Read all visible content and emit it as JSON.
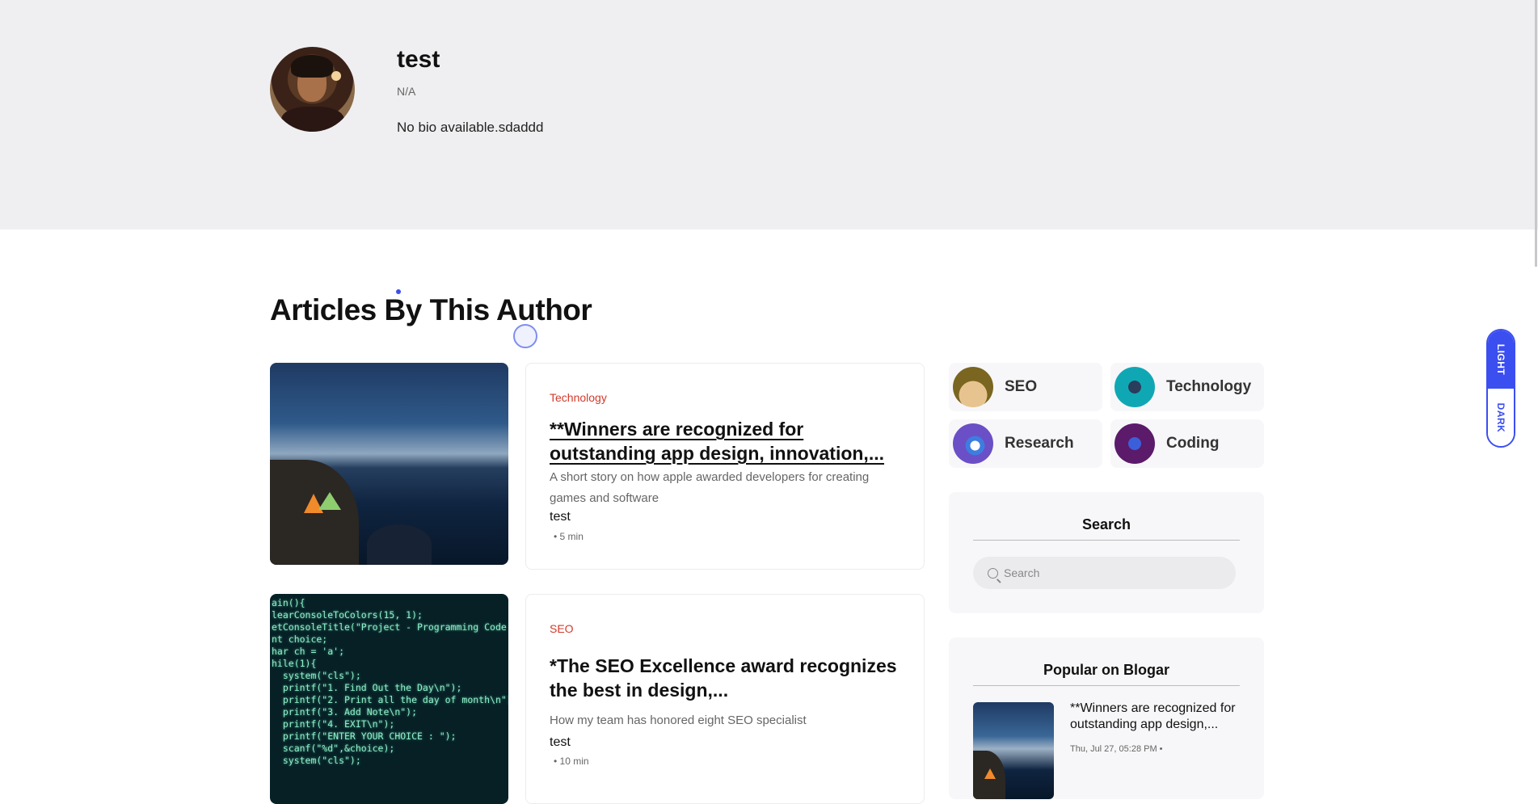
{
  "author": {
    "name": "test",
    "role": "N/A",
    "bio": "No bio available.sdaddd"
  },
  "section": {
    "title": "Articles By This Author"
  },
  "articles": [
    {
      "category": "Technology",
      "title": "**Winners are recognized for outstanding app design, innovation,...",
      "excerpt": "A short story on how apple awarded developers for creating games and software",
      "author": "test",
      "read_time": "• 5 min"
    },
    {
      "category": "SEO",
      "title": "*The SEO Excellence award recognizes the best in design,...",
      "excerpt": "How my team has honored eight SEO specialist",
      "author": "test",
      "read_time": "• 10 min"
    }
  ],
  "categories": [
    {
      "label": "SEO",
      "icon": "seo-icon"
    },
    {
      "label": "Technology",
      "icon": "robot-hand-icon"
    },
    {
      "label": "Research",
      "icon": "magnifier-icon"
    },
    {
      "label": "Coding",
      "icon": "code-tablet-icon"
    }
  ],
  "search": {
    "heading": "Search",
    "placeholder": "Search",
    "icon": "search-icon"
  },
  "popular": {
    "heading": "Popular on Blogar",
    "items": [
      {
        "title": "**Winners are recognized for outstanding app design,...",
        "meta": "Thu, Jul 27, 05:28 PM •"
      }
    ]
  },
  "theme": {
    "light_label": "LIGHT",
    "dark_label": "DARK",
    "accent": "#3b4ef0"
  },
  "colors": {
    "category": "#d23a2a",
    "header_bg": "#efeff1"
  }
}
